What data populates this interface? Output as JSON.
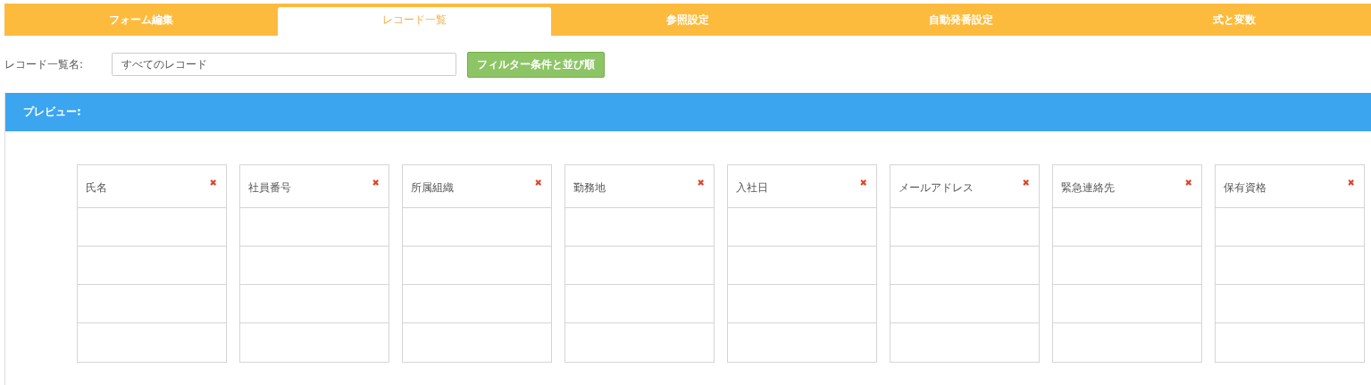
{
  "tabs": [
    {
      "label": "フォーム編集",
      "selected": false
    },
    {
      "label": "レコード一覧",
      "selected": true
    },
    {
      "label": "参照設定",
      "selected": false
    },
    {
      "label": "自動発番設定",
      "selected": false
    },
    {
      "label": "式と変数",
      "selected": false
    }
  ],
  "list_name": {
    "label": "レコード一覧名:",
    "value": "すべてのレコード"
  },
  "filter_button": "フィルター条件と並び順",
  "preview": {
    "title": "プレビュー:",
    "columns": [
      {
        "name": "氏名",
        "remove": "✖"
      },
      {
        "name": "社員番号",
        "remove": "✖"
      },
      {
        "name": "所属組織",
        "remove": "✖"
      },
      {
        "name": "勤務地",
        "remove": "✖"
      },
      {
        "name": "入社日",
        "remove": "✖"
      },
      {
        "name": "メールアドレス",
        "remove": "✖"
      },
      {
        "name": "緊急連絡先",
        "remove": "✖"
      },
      {
        "name": "保有資格",
        "remove": "✖"
      }
    ]
  }
}
